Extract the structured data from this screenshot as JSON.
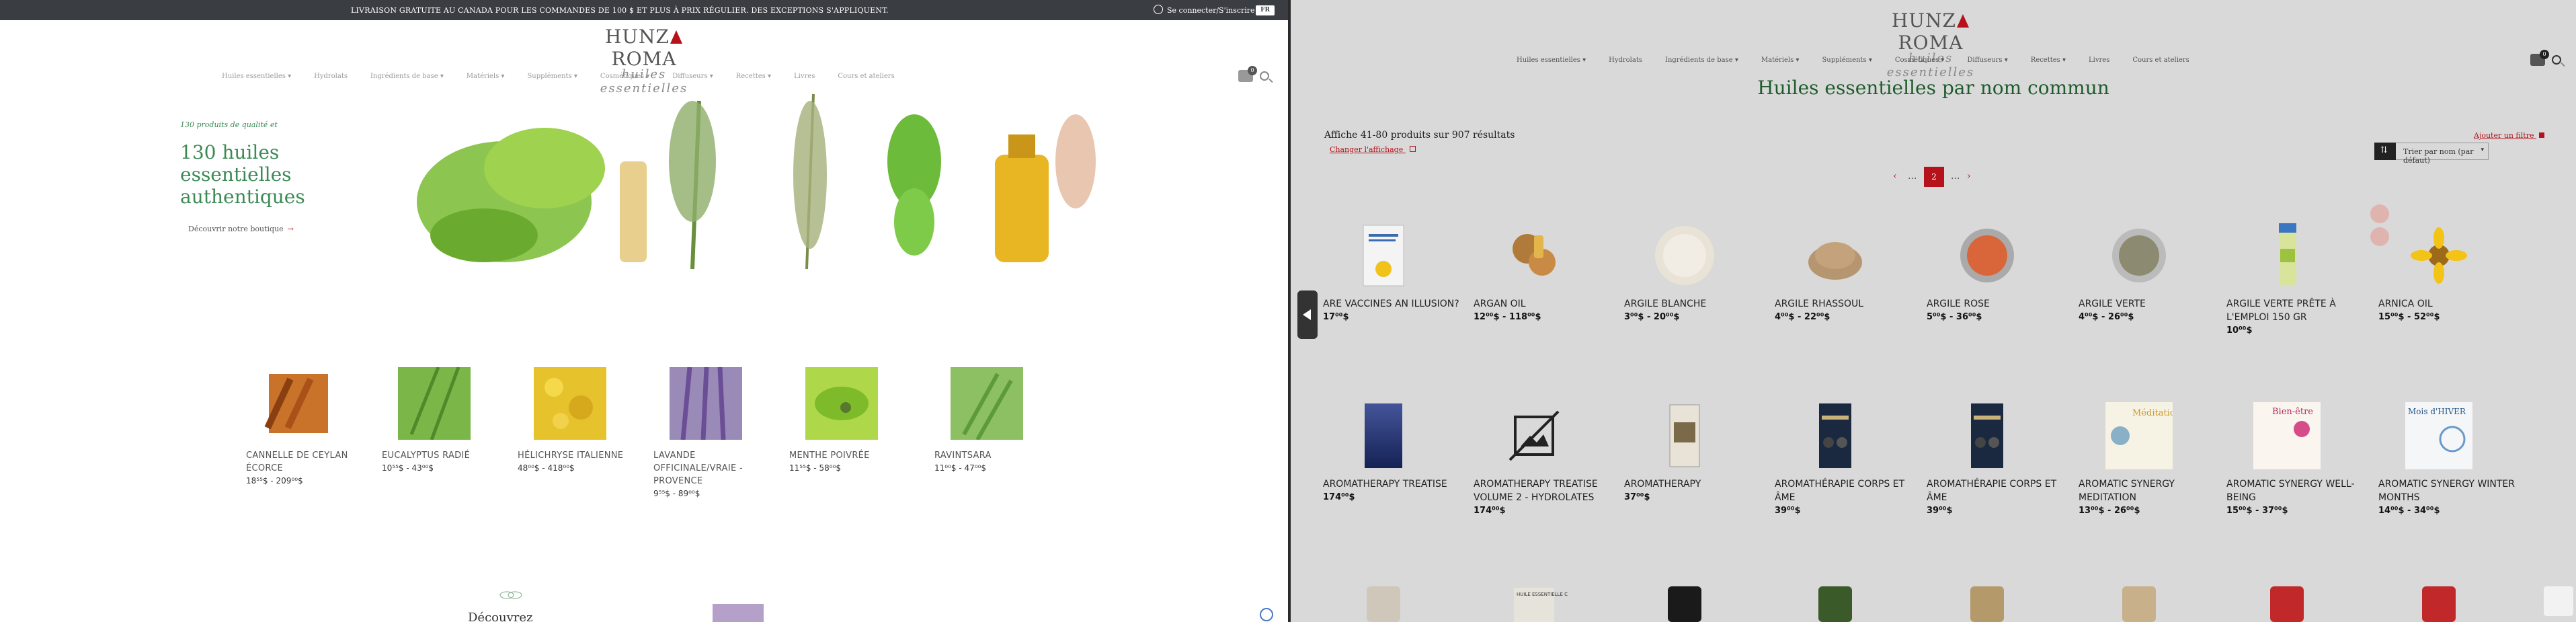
{
  "left": {
    "topbar": {
      "promo": "LIVRAISON GRATUITE AU CANADA POUR LES COMMANDES DE 100 $ ET PLUS À PRIX RÉGULIER. DES EXCEPTIONS S'APPLIQUENT.",
      "account": "Se connecter/S'inscrire",
      "lang": "FR"
    },
    "logo": {
      "name_a": "HUNZ",
      "name_b": "ROMA",
      "sub": "huiles essentielles"
    },
    "nav": [
      "Huiles essentielles ▾",
      "Hydrolats",
      "Ingrédients de base ▾",
      "Matériels ▾",
      "Suppléments ▾",
      "Cosmétiques ▾",
      "Diffuseurs ▾",
      "Recettes ▾",
      "Livres",
      "Cours et ateliers"
    ],
    "cart_count": "0",
    "hero": {
      "eyebrow": "130 produits de qualité et",
      "title": "130 huiles essentielles authentiques",
      "cta": "Découvrir notre boutique",
      "cta_arrow": "→"
    },
    "products": [
      {
        "name": "CANNELLE DE CEYLAN ÉCORCE",
        "price": "18⁵⁵$ - 209⁰⁰$"
      },
      {
        "name": "EUCALYPTUS RADIÉ",
        "price": "10⁵⁵$ - 43⁰⁰$"
      },
      {
        "name": "HÉLICHRYSE ITALIENNE",
        "price": "48⁰⁰$ - 418⁰⁰$"
      },
      {
        "name": "LAVANDE OFFICINALE/VRAIE - PROVENCE",
        "price": "9⁵⁵$ - 89⁰⁰$"
      },
      {
        "name": "MENTHE POIVRÉE",
        "price": "11⁵⁵$ - 58⁰⁰$"
      },
      {
        "name": "RAVINTSARA",
        "price": "11⁰⁰$ - 47⁰⁰$"
      }
    ],
    "section_title": "Découvrez"
  },
  "right": {
    "logo": {
      "name_a": "HUNZ",
      "name_b": "ROMA",
      "sub": "huiles essentielles"
    },
    "nav": [
      "Huiles essentielles ▾",
      "Hydrolats",
      "Ingrédients de base ▾",
      "Matériels ▾",
      "Suppléments ▾",
      "Cosmétiques ▾",
      "Diffuseurs ▾",
      "Recettes ▾",
      "Livres",
      "Cours et ateliers"
    ],
    "cart_count": "0",
    "title": "Huiles essentielles par nom commun",
    "results": "Affiche 41-80 produits sur 907 résultats",
    "change_view": "Changer l'affichage",
    "add_filter": "Ajouter un filtre",
    "sort": "Trier par nom (par défaut)",
    "pager": {
      "prev": "‹",
      "dots1": "...",
      "current": "2",
      "dots2": "...",
      "next": "›"
    },
    "products_row1": [
      {
        "name": "ARE VACCINES AN ILLUSION?",
        "price": "17⁰⁰$"
      },
      {
        "name": "ARGAN OIL",
        "price": "12⁰⁰$ - 118⁰⁰$"
      },
      {
        "name": "ARGILE BLANCHE",
        "price": "3⁰⁰$ - 20⁰⁰$"
      },
      {
        "name": "ARGILE RHASSOUL",
        "price": "4⁰⁰$ - 22⁰⁰$"
      },
      {
        "name": "ARGILE ROSE",
        "price": "5⁰⁰$ - 36⁰⁰$"
      },
      {
        "name": "ARGILE VERTE",
        "price": "4⁰⁰$ - 26⁰⁰$"
      },
      {
        "name": "ARGILE VERTE PRÊTE À L'EMPLOI 150 GR",
        "price": "10⁰⁰$"
      },
      {
        "name": "ARNICA OIL",
        "price": "15⁰⁰$ - 52⁰⁰$"
      }
    ],
    "products_row2": [
      {
        "name": "AROMATHERAPY TREATISE",
        "price": "174⁰⁰$"
      },
      {
        "name": "AROMATHERAPY TREATISE VOLUME 2 - HYDROLATES",
        "price": "174⁰⁰$"
      },
      {
        "name": "AROMATHERAPY",
        "price": "37⁰⁰$"
      },
      {
        "name": "AROMATHÉRAPIE CORPS ET ÂME",
        "price": "39⁰⁰$"
      },
      {
        "name": "AROMATHÉRAPIE CORPS ET ÂME",
        "price": "39⁰⁰$"
      },
      {
        "name": "AROMATIC SYNERGY MEDITATION",
        "price": "13⁰⁰$ - 26⁰⁰$"
      },
      {
        "name": "AROMATIC SYNERGY WELL-BEING",
        "price": "15⁰⁰$ - 37⁰⁰$"
      },
      {
        "name": "AROMATIC SYNERGY WINTER MONTHS",
        "price": "14⁰⁰$ - 34⁰⁰$"
      }
    ],
    "book_labels": {
      "b1_title": "LES VACCINS SONT-ILS UNE ILLUSION ?",
      "meditation": "Méditation",
      "bien_etre": "Bien-être",
      "mois_hiver": "Mois d'HIVER",
      "cedre": "HUILE ESSENTIELLE CÈDRE"
    }
  },
  "colors": {
    "brand_red": "#b5121b",
    "brand_green": "#3b8a55",
    "title_green": "#1e5c2c",
    "topbar": "#3a3d42"
  }
}
